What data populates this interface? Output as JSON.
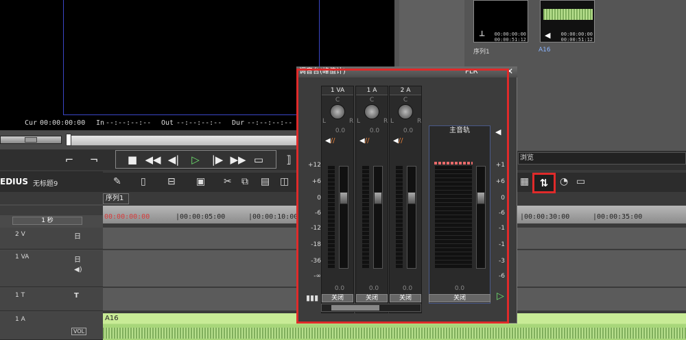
{
  "preview": {
    "cur_label": "Cur",
    "cur_value": "00:00:00:00",
    "in_label": "In",
    "in_value": "--:--:--:--",
    "out_label": "Out",
    "out_value": "--:--:--:--",
    "dur_label": "Dur",
    "dur_value": "--:--:--:--"
  },
  "bin": {
    "clips": [
      {
        "label": "序列1",
        "tc1": "00:00:00:00",
        "tc2": "00:00:51:12"
      },
      {
        "label": "A16",
        "tc1": "00:00:00:00",
        "tc2": "00:00:51:12"
      }
    ],
    "right_bar": "浏览"
  },
  "timeline": {
    "app": "EDIUS",
    "project": "无标题9",
    "sequence_tab": "序列1",
    "scale": "1 秒",
    "ruler": [
      "00:00:00:00",
      "|00:00:05:00",
      "|00:00:10:00",
      "|00:00:30:00",
      "|00:00:35:00"
    ],
    "tracks": [
      {
        "name": "2 V",
        "icon": "日"
      },
      {
        "name": "1 VA",
        "icon": "日"
      },
      {
        "name": "1 T",
        "icon": "T"
      },
      {
        "name": "1 A",
        "icon": "VOL"
      }
    ],
    "audio_clip": "A16"
  },
  "mixer": {
    "title": "调音台(峰值计)",
    "title_right": "PLR",
    "channels": [
      {
        "name": "1 VA",
        "pan": "C",
        "left": "L",
        "right": "R",
        "pan_value": "0.0",
        "gain_value": "0.0",
        "mode": "关闭"
      },
      {
        "name": "1 A",
        "pan": "C",
        "left": "L",
        "right": "R",
        "pan_value": "0.0",
        "gain_value": "0.0",
        "mode": "关闭"
      },
      {
        "name": "2 A",
        "pan": "C",
        "left": "L",
        "right": "R",
        "pan_value": "0.0",
        "gain_value": "0.0",
        "mode": "关闭"
      }
    ],
    "master": {
      "name": "主音轨",
      "gain_value": "0.0",
      "mode": "关闭"
    },
    "scale_left": [
      "+12",
      "+6",
      "0",
      "-6",
      "-12",
      "-18",
      "-36",
      "-∞"
    ],
    "scale_right": [
      "+1",
      "+6",
      "0",
      "-6",
      "-1",
      "-1",
      "-3",
      "-6"
    ]
  },
  "colors": {
    "highlight": "#e02a2a",
    "play": "#6ee06e",
    "audio_clip": "#c8eb96"
  }
}
